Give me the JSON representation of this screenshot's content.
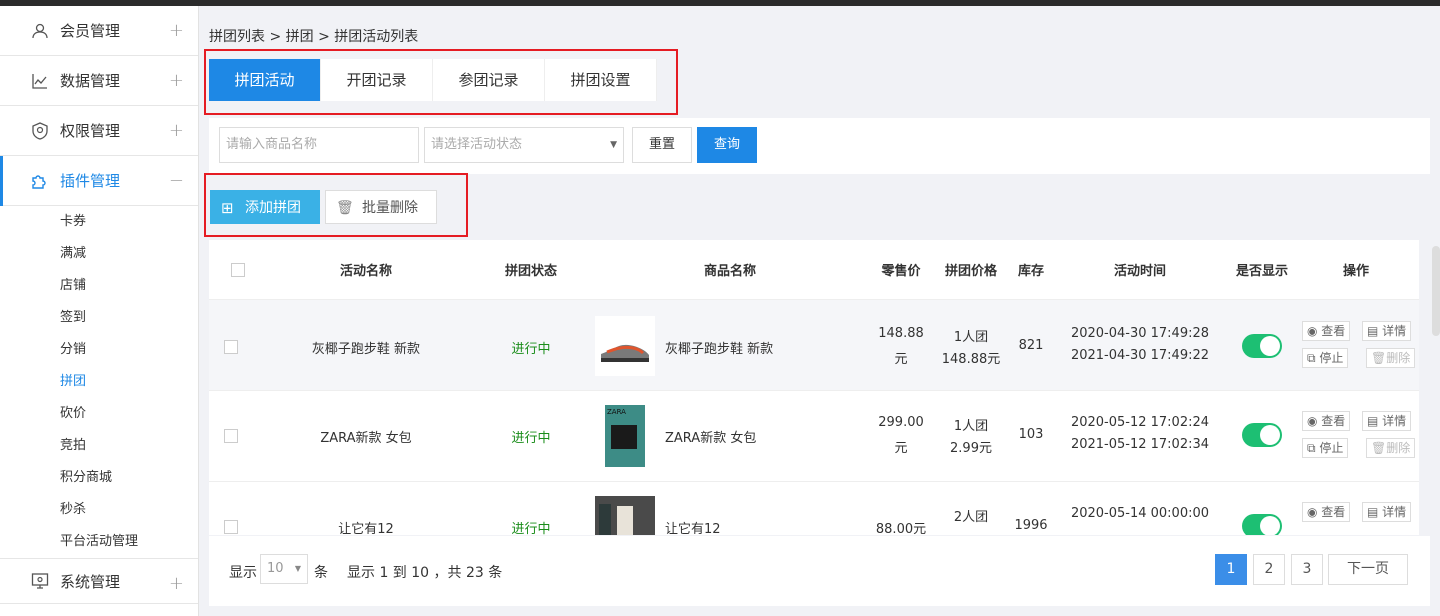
{
  "sidebar": {
    "menus_top": [
      {
        "label": "会员管理",
        "icon": "user-icon"
      },
      {
        "label": "数据管理",
        "icon": "chart-line-icon"
      },
      {
        "label": "权限管理",
        "icon": "shield-icon"
      },
      {
        "label": "插件管理",
        "icon": "puzzle-icon"
      }
    ],
    "submenu": [
      "卡券",
      "满减",
      "店铺",
      "签到",
      "分销",
      "拼团",
      "砍价",
      "竞拍",
      "积分商城",
      "秒杀",
      "平台活动管理"
    ],
    "menu_bottom": {
      "label": "系统管理",
      "icon": "monitor-icon"
    },
    "plus": "+",
    "minus": "−"
  },
  "breadcrumb": "拼团列表 > 拼团 > 拼团活动列表",
  "tabs": [
    "拼团活动",
    "开团记录",
    "参团记录",
    "拼团设置"
  ],
  "filter": {
    "product_placeholder": "请输入商品名称",
    "status_placeholder": "请选择活动状态",
    "reset": "重置",
    "query": "查询"
  },
  "actions": {
    "add": "添加拼团",
    "batch_delete": "批量删除"
  },
  "table": {
    "headers": [
      "活动名称",
      "拼团状态",
      "商品名称",
      "零售价",
      "拼团价格",
      "库存",
      "活动时间",
      "是否显示",
      "操作"
    ],
    "rows": [
      {
        "name": "灰椰子跑步鞋 新款",
        "status": "进行中",
        "product": "灰椰子跑步鞋 新款",
        "price1": "148.88",
        "price2": "元",
        "group1": "1人团",
        "group2": "148.88元",
        "stock": "821",
        "time1": "2020-04-30 17:49:28",
        "time2": "2021-04-30 17:49:22"
      },
      {
        "name": "ZARA新款 女包",
        "status": "进行中",
        "product": "ZARA新款 女包",
        "price1": "299.00",
        "price2": "元",
        "group1": "1人团",
        "group2": "2.99元",
        "stock": "103",
        "time1": "2020-05-12 17:02:24",
        "time2": "2021-05-12 17:02:34"
      },
      {
        "name": "让它有12",
        "status": "进行中",
        "product": "让它有12",
        "price1": "88.00元",
        "price2": "",
        "group1": "2人团",
        "group2": "",
        "stock": "1996",
        "time1": "2020-05-14 00:00:00",
        "time2": ""
      }
    ],
    "ops": {
      "view": "查看",
      "detail": "详情",
      "stop": "停止",
      "delete": "删除"
    },
    "row_highlight_color": "#f5f6f9",
    "toggle_color": "#1dbf73"
  },
  "footer": {
    "show": "显示",
    "per_page": "10",
    "unit": "条",
    "summary": "显示 1 到 10 ，共 23 条",
    "pages": [
      "1",
      "2",
      "3"
    ],
    "next": "下一页"
  },
  "colors": {
    "accent": "#1e88e5",
    "add_button": "#3ab1e6",
    "highlight_box": "#e51c23"
  }
}
